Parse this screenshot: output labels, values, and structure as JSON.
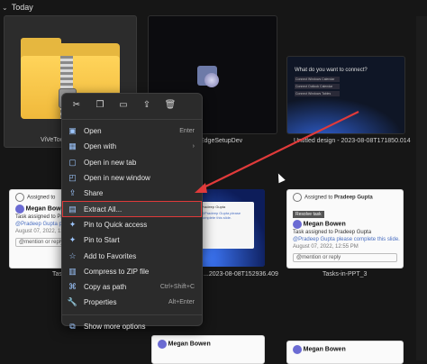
{
  "group": {
    "title": "Today"
  },
  "files": [
    {
      "name": "ViVeTool-..."
    },
    {
      "name": "EdgeSetupDev"
    },
    {
      "name": "Untitled design - 2023-08-08T171850.014"
    },
    {
      "name": "Task..."
    },
    {
      "name": "...2023-08-08T152936.409"
    },
    {
      "name": "Tasks-in-PPT_3"
    }
  ],
  "thumb_design": {
    "question": "What do you want to connect?",
    "options": [
      "Connect Windows Calendar",
      "Connect Outlook Calendar",
      "Connect Windows Tables"
    ]
  },
  "thumb_task": {
    "assigned": "Assigned to ",
    "assignee": "Pradeep Gupta",
    "user": "Megan Bowen",
    "action": "Task assigned to Pradeep Gupta",
    "mention": "@Pradeep Gupta please complete this slide.",
    "date": "August 07, 2022, 12:55 PM",
    "reply": "@mention or reply",
    "resolve": "Resolve task"
  },
  "context_menu": {
    "toolbar": [
      "cut-icon",
      "copy-icon",
      "rename-icon",
      "share-icon",
      "delete-icon"
    ],
    "items": [
      {
        "label": "Open",
        "shortcut": "Enter",
        "icon": "open-icon"
      },
      {
        "label": "Open with",
        "shortcut": "›",
        "icon": "open-with-icon"
      },
      {
        "label": "Open in new tab",
        "shortcut": "",
        "icon": "new-tab-icon"
      },
      {
        "label": "Open in new window",
        "shortcut": "",
        "icon": "new-window-icon"
      },
      {
        "label": "Share",
        "shortcut": "",
        "icon": "share-icon"
      },
      {
        "label": "Extract All...",
        "shortcut": "",
        "icon": "extract-icon",
        "highlighted": true
      },
      {
        "label": "Pin to Quick access",
        "shortcut": "",
        "icon": "pin-icon"
      },
      {
        "label": "Pin to Start",
        "shortcut": "",
        "icon": "pin-start-icon"
      },
      {
        "label": "Add to Favorites",
        "shortcut": "",
        "icon": "star-icon"
      },
      {
        "label": "Compress to ZIP file",
        "shortcut": "",
        "icon": "zip-icon"
      },
      {
        "label": "Copy as path",
        "shortcut": "Ctrl+Shift+C",
        "icon": "path-icon"
      },
      {
        "label": "Properties",
        "shortcut": "Alt+Enter",
        "icon": "properties-icon"
      },
      {
        "label": "Show more options",
        "shortcut": "",
        "icon": "more-options-icon"
      }
    ]
  },
  "colors": {
    "highlight": "#e03a3a",
    "arrow": "#e03a3a",
    "accent": "#9ec7ff"
  }
}
